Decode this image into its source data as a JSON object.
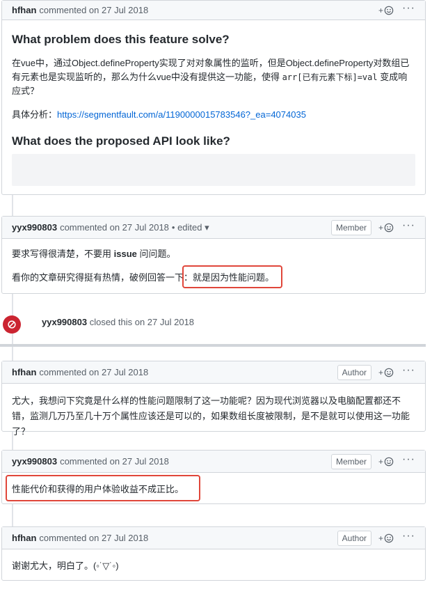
{
  "comments": [
    {
      "author": "hfhan",
      "meta": "commented on 27 Jul 2018",
      "heading1": "What problem does this feature solve?",
      "para1_pre": "在vue中，通过Object.defineProperty实现了对对象属性的监听，但是Object.defineProperty对数组已有元素也是实现监听的，那么为什么vue中没有提供这一功能，使得 ",
      "para1_code": "arr[已有元素下标]=val",
      "para1_post": " 变成响应式？",
      "analysis_label": "具体分析：",
      "analysis_link": "https://segmentfault.com/a/1190000015783546?_ea=4074035",
      "heading2": "What does the proposed API look like?"
    },
    {
      "author": "yyx990803",
      "meta": "commented on 27 Jul 2018",
      "edited": "• edited ▾",
      "badge": "Member",
      "line1_pre": "要求写得很清楚，不要用 ",
      "line1_bold": "issue",
      "line1_post": " 问问题。",
      "line2_pre": "看你的文章研究得挺有热情，破例回答一下：",
      "line2_highlight": "就是因为性能问题。"
    },
    {
      "author": "hfhan",
      "meta": "commented on 27 Jul 2018",
      "badge": "Author",
      "body": "尤大，我想问下究竟是什么样的性能问题限制了这一功能呢？因为现代浏览器以及电脑配置都还不错，监测几万乃至几十万个属性应该还是可以的，如果数组长度被限制，是不是就可以使用这一功能了？"
    },
    {
      "author": "yyx990803",
      "meta": "commented on 27 Jul 2018",
      "badge": "Member",
      "body": "性能代价和获得的用户体验收益不成正比。"
    },
    {
      "author": "hfhan",
      "meta": "commented on 27 Jul 2018",
      "badge": "Author",
      "body": "谢谢尤大，明白了。(◦˙▽˙◦)"
    }
  ],
  "closed_event": {
    "author": "yyx990803",
    "text": "closed this on 27 Jul 2018"
  },
  "actions": {
    "reaction_plus": "+",
    "more": "···"
  },
  "colors": {
    "highlight": "#e0463a",
    "closed": "#cb2431",
    "link": "#0366d6"
  }
}
